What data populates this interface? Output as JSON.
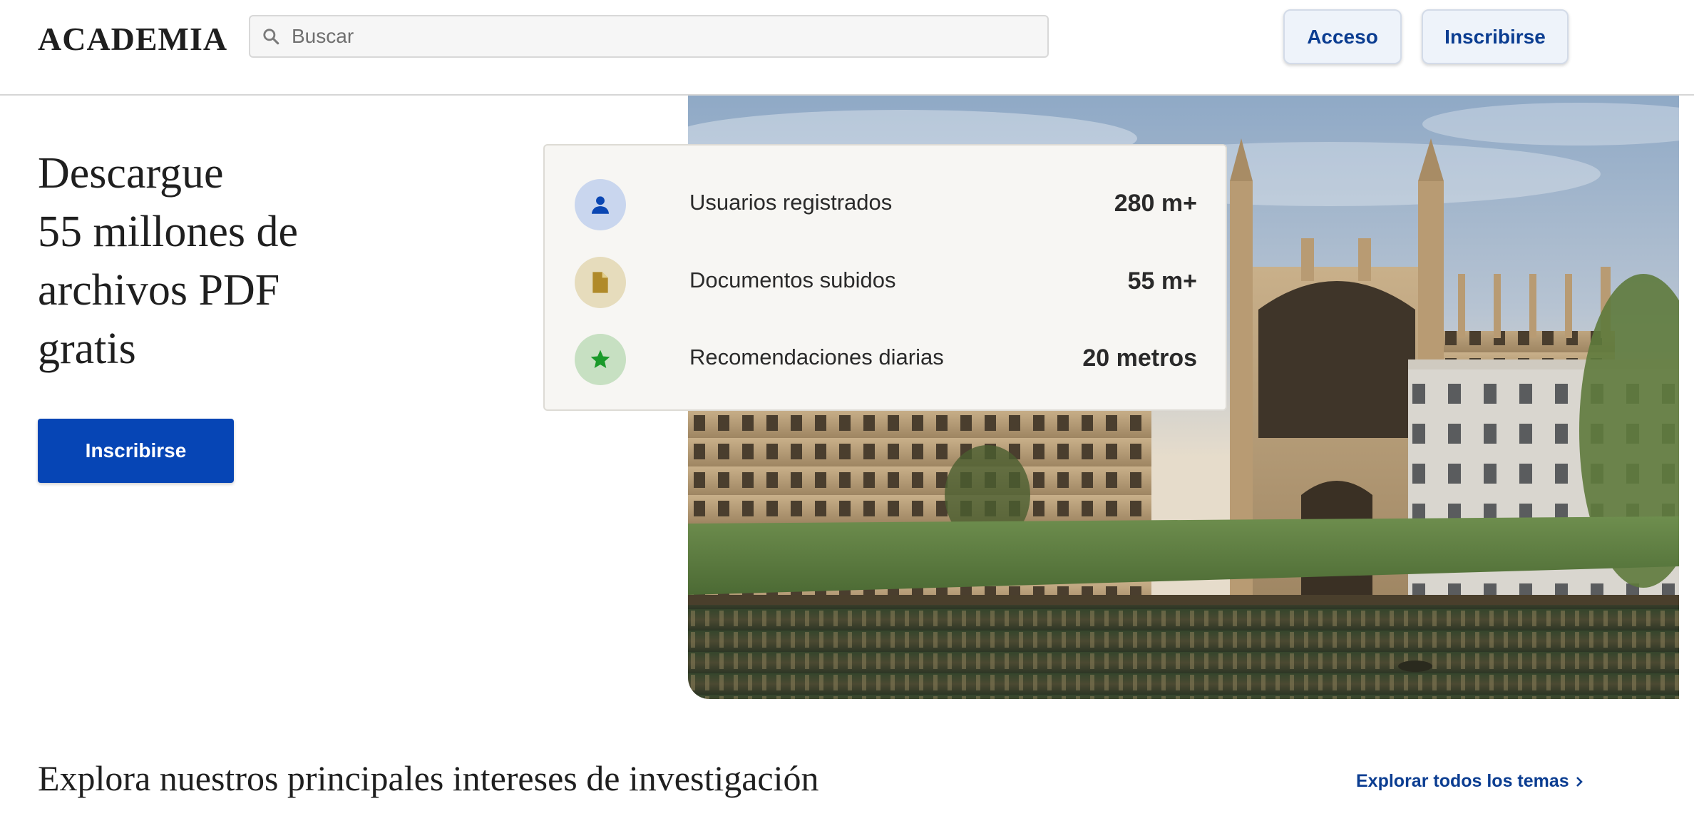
{
  "header": {
    "logo": "ACADEMIA",
    "search_placeholder": "Buscar",
    "login_label": "Acceso",
    "signup_label": "Inscribirse"
  },
  "hero": {
    "title_lines": [
      "Descargue",
      "55 millones de",
      "archivos PDF",
      "gratis"
    ],
    "cta_label": "Inscribirse"
  },
  "stats": [
    {
      "icon": "user-icon",
      "icon_bg": "#c9d6ee",
      "icon_color": "#0b47b3",
      "label": "Usuarios registrados",
      "value": "280 m+"
    },
    {
      "icon": "document-icon",
      "icon_bg": "#e6dcbc",
      "icon_color": "#b08a2a",
      "label": "Documentos subidos",
      "value": "55 m+"
    },
    {
      "icon": "star-icon",
      "icon_bg": "#c7e0c2",
      "icon_color": "#1a9a2a",
      "label": "Recomendaciones diarias",
      "value": "20 metros"
    }
  ],
  "section": {
    "title": "Explora nuestros principales intereses de investigación",
    "explore_link": "Explorar todos los temas"
  },
  "colors": {
    "brand_blue": "#0645b5",
    "link_blue": "#0b3d91"
  }
}
